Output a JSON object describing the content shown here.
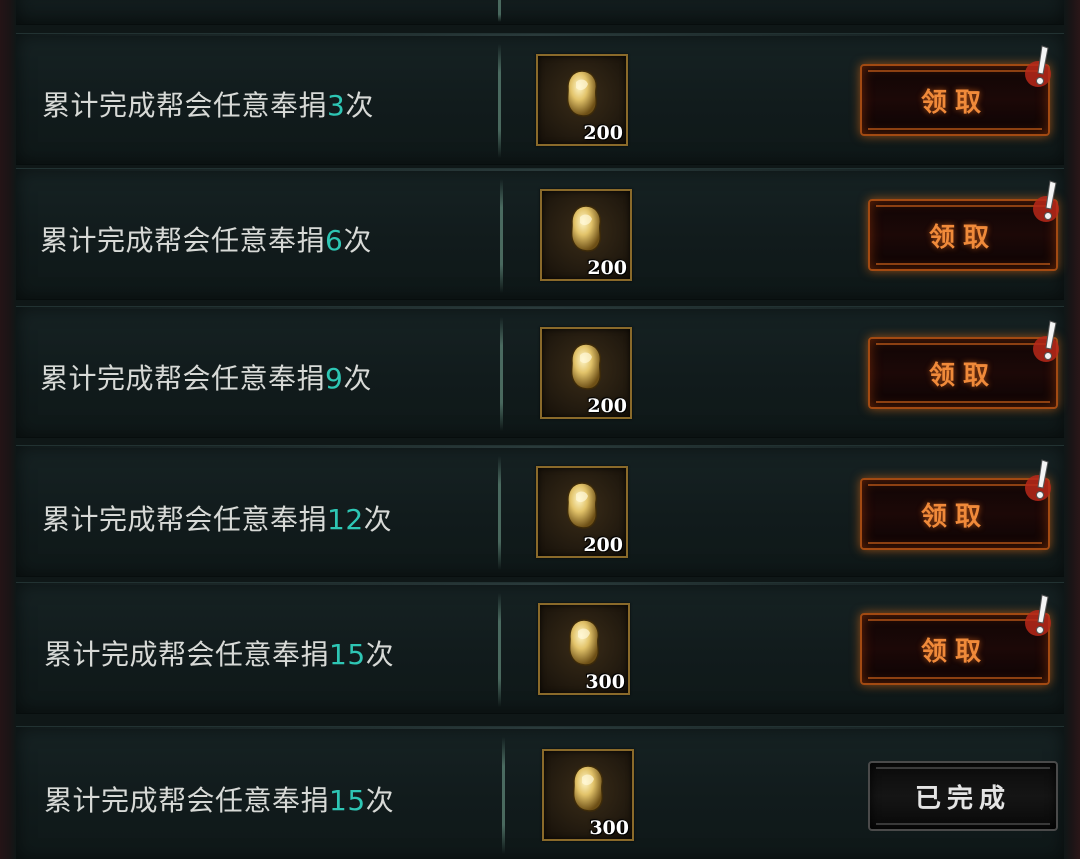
{
  "panel": {
    "rows": [
      {
        "text": "累计完成帮会任意奉捐",
        "count": "3",
        "unit": "次",
        "reward_qty": "200",
        "action": "领取"
      },
      {
        "text": "累计完成帮会任意奉捐",
        "count": "6",
        "unit": "次",
        "reward_qty": "200",
        "action": "领取"
      },
      {
        "text": "累计完成帮会任意奉捐",
        "count": "9",
        "unit": "次",
        "reward_qty": "200",
        "action": "领取"
      },
      {
        "text": "累计完成帮会任意奉捐",
        "count": "12",
        "unit": "次",
        "reward_qty": "200",
        "action": "领取"
      },
      {
        "text": "累计完成帮会任意奉捐",
        "count": "15",
        "unit": "次",
        "reward_qty": "300",
        "action": "领取"
      },
      {
        "text": "累计完成帮会任意奉捐",
        "count": "15",
        "unit": "次",
        "reward_qty": "300",
        "action": "已完成"
      }
    ]
  },
  "icons": {
    "reward": "gold-ingot-icon",
    "alert": "exclamation-alert-icon"
  },
  "colors": {
    "count_highlight": "#2ec6b4",
    "claim_text": "#f08a3a",
    "claim_border": "#a24a12",
    "done_text": "#e4e4e4",
    "reward_frame": "#8a6a2a"
  }
}
